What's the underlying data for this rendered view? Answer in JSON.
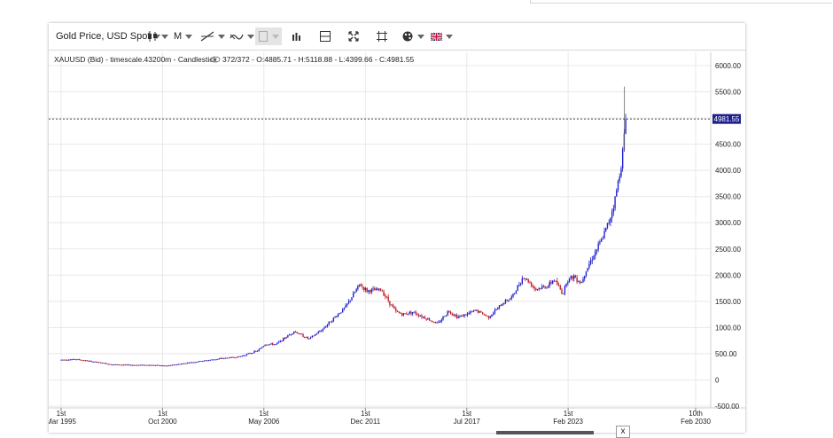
{
  "toolbar": {
    "symbol_label": "Gold Price, USD Spot",
    "period_label": "M"
  },
  "info_line": "XAUUSD (Bid) - timescale.43200m - Candlestick",
  "info_stats": "372/372 - O:4885.71 - H:5118.88 - L:4399.66 - C:4981.55",
  "current_price_label": "4981.55",
  "colors": {
    "bull": "#1f1fd0",
    "bear": "#c0181f",
    "price_tag_bg": "#1f1f8f",
    "grid": "#e8e8e8"
  },
  "chart_data": {
    "type": "candlestick",
    "symbol": "XAUUSD (Bid)",
    "timescale": "43200m",
    "bar_count": "372/372",
    "last_bar": {
      "open": 4885.71,
      "high": 5118.88,
      "low": 4399.66,
      "close": 4981.55
    },
    "current_price": 4981.55,
    "ylim": [
      -500,
      6000
    ],
    "yticks": [
      "6000.00",
      "5500.00",
      "5000.00",
      "4500.00",
      "4000.00",
      "3500.00",
      "3000.00",
      "2500.00",
      "2000.00",
      "1500.00",
      "1000.00",
      "500.00",
      "0",
      "-500.00"
    ],
    "ytick_values": [
      6000,
      5500,
      5000,
      4500,
      4000,
      3500,
      3000,
      2500,
      2000,
      1500,
      1000,
      500,
      0,
      -500
    ],
    "xticks": [
      {
        "line1": "1st",
        "line2": "Mar 1995",
        "year": 1995.17
      },
      {
        "line1": "1st",
        "line2": "Oct 2000",
        "year": 2000.75
      },
      {
        "line1": "1st",
        "line2": "May 2006",
        "year": 2006.33
      },
      {
        "line1": "1st",
        "line2": "Dec 2011",
        "year": 2011.92
      },
      {
        "line1": "1st",
        "line2": "Jul 2017",
        "year": 2017.5
      },
      {
        "line1": "1st",
        "line2": "Feb 2023",
        "year": 2023.08
      },
      {
        "line1": "10th",
        "line2": "Feb 2030",
        "year": 2030.1
      }
    ],
    "xlim": [
      1995.17,
      2030.1
    ],
    "price_path": [
      [
        1995.17,
        385
      ],
      [
        1996.0,
        395
      ],
      [
        1997.0,
        345
      ],
      [
        1998.0,
        295
      ],
      [
        1999.0,
        285
      ],
      [
        2000.0,
        285
      ],
      [
        2001.0,
        270
      ],
      [
        2002.0,
        320
      ],
      [
        2003.0,
        365
      ],
      [
        2004.0,
        410
      ],
      [
        2005.0,
        445
      ],
      [
        2006.0,
        560
      ],
      [
        2006.4,
        680
      ],
      [
        2007.0,
        680
      ],
      [
        2008.0,
        930
      ],
      [
        2008.8,
        780
      ],
      [
        2009.5,
        950
      ],
      [
        2010.0,
        1120
      ],
      [
        2010.8,
        1380
      ],
      [
        2011.6,
        1820
      ],
      [
        2012.0,
        1700
      ],
      [
        2012.8,
        1720
      ],
      [
        2013.3,
        1450
      ],
      [
        2013.6,
        1300
      ],
      [
        2014.0,
        1250
      ],
      [
        2014.5,
        1300
      ],
      [
        2015.0,
        1220
      ],
      [
        2015.9,
        1070
      ],
      [
        2016.5,
        1320
      ],
      [
        2017.0,
        1200
      ],
      [
        2017.5,
        1250
      ],
      [
        2018.0,
        1330
      ],
      [
        2018.7,
        1200
      ],
      [
        2019.0,
        1300
      ],
      [
        2019.6,
        1500
      ],
      [
        2020.0,
        1580
      ],
      [
        2020.6,
        1970
      ],
      [
        2021.0,
        1850
      ],
      [
        2021.3,
        1730
      ],
      [
        2022.0,
        1800
      ],
      [
        2022.3,
        1920
      ],
      [
        2022.8,
        1640
      ],
      [
        2023.0,
        1900
      ],
      [
        2023.4,
        1980
      ],
      [
        2023.8,
        1850
      ],
      [
        2024.0,
        2050
      ],
      [
        2024.5,
        2400
      ],
      [
        2024.9,
        2650
      ],
      [
        2025.3,
        3000
      ],
      [
        2025.6,
        3350
      ],
      [
        2025.9,
        3900
      ],
      [
        2026.1,
        4400
      ],
      [
        2026.25,
        4982
      ]
    ],
    "spikes": [
      {
        "year": 2026.18,
        "high": 5600,
        "low": 4400
      }
    ]
  }
}
